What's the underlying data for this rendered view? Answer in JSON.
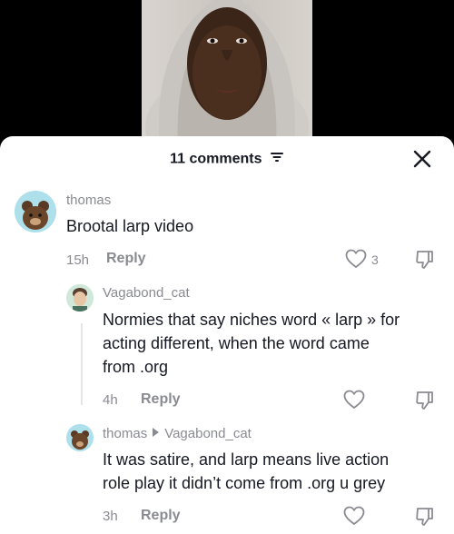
{
  "header": {
    "comment_count": "11 comments"
  },
  "comments": [
    {
      "username": "thomas",
      "text": "Brootal larp video",
      "time": "15h",
      "reply": "Reply",
      "likes": "3"
    },
    {
      "username": "Vagabond_cat",
      "text_lines": [
        "Normies that say niches word « larp » for",
        "acting different, when the word came",
        "from .org"
      ],
      "time": "4h",
      "reply": "Reply"
    },
    {
      "username": "thomas",
      "reply_to": "Vagabond_cat",
      "text_lines": [
        "It was satire, and larp means live action",
        "role play it didn’t come from .org u grey"
      ],
      "time": "3h",
      "reply": "Reply"
    }
  ]
}
